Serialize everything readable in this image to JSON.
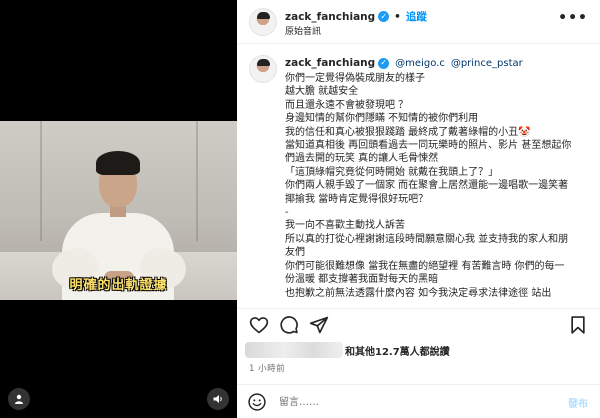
{
  "media": {
    "subtitle": "明確的出軌證據",
    "left_button_icon": "person-icon",
    "right_button_icon": "speaker-icon"
  },
  "header": {
    "username": "zack_fanchiang",
    "separator": "•",
    "follow_label": "追蹤",
    "subtitle": "原始音訊",
    "more_icon": "more-horizontal-icon"
  },
  "caption": {
    "username": "zack_fanchiang",
    "mentions": [
      "@meigo.c",
      "@prince_pstar"
    ],
    "lines": [
      "你們一定覺得偽裝成朋友的樣子",
      "越大膽 就越安全",
      "而且還永遠不會被發現吧 ？",
      "身邊知情的幫你們隱瞞 不知情的被你們利用",
      "我的信任和真心被狠狠踐踏 最終成了戴著綠帽的小丑🤡",
      "當知道真相後 再回頭看過去一同玩樂時的照片、影片 甚至想起你",
      "們過去開的玩笑 真的讓人毛骨悚然",
      "「這頂綠帽究竟從何時開始 就戴在我頭上了？」",
      "你們兩人親手毀了一個家 而在聚會上居然還能一邊唱歌一邊笑著",
      "揶揄我 當時肯定覺得很好玩吧？",
      "-",
      "我一向不喜歡主動找人訴苦",
      "所以真的打從心裡謝謝這段時間願意關心我 並支持我的家人和朋",
      "友們",
      "你們可能很難想像 當我在無盡的絕望裡 有苦難言時 你們的每一",
      "份溫暖 都支撐著我面對每天的黑暗",
      "也抱歉之前無法透露什麼內容 如今我決定尋求法律途徑 站出"
    ]
  },
  "actions": {
    "like_icon": "heart-icon",
    "comment_icon": "comment-icon",
    "share_icon": "share-icon",
    "save_icon": "bookmark-icon"
  },
  "likes": {
    "text": "和其他12.7萬人都說讚"
  },
  "time": "1 小時前",
  "comment_box": {
    "emoji_icon": "emoji-icon",
    "placeholder": "留言……",
    "post_label": "發布"
  },
  "colors": {
    "accent": "#0095f6",
    "verified": "#1d9bf0",
    "subtitle_text": "#ffe36a",
    "mention": "#00376b",
    "muted": "#737373"
  }
}
